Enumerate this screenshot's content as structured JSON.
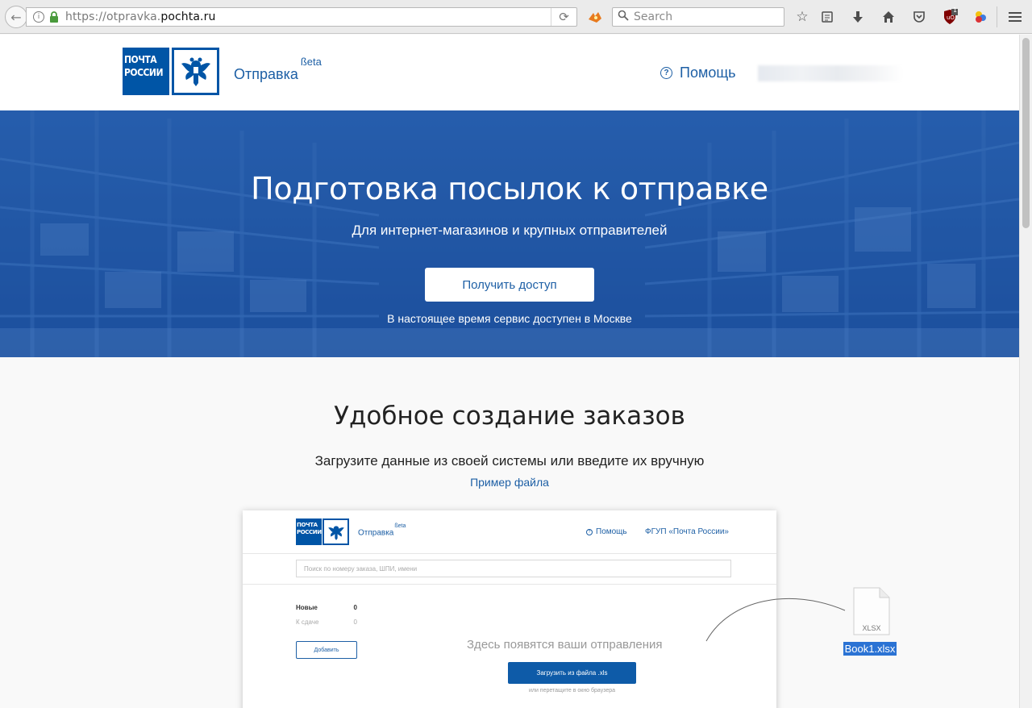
{
  "browser": {
    "url_prefix": "https://otpravka.",
    "url_domain": "pochta.ru",
    "search_placeholder": "Search",
    "ublock_count": "1"
  },
  "header": {
    "logo_line1": "ПОЧТА",
    "logo_line2": "РОССИИ",
    "brand": "Отправка",
    "brand_sup": "ßeta",
    "help": "Помощь"
  },
  "hero": {
    "title": "Подготовка посылок к отправке",
    "subtitle": "Для интернет-магазинов и крупных отправителей",
    "button": "Получить доступ",
    "note": "В настоящее время сервис доступен в Москве"
  },
  "features": {
    "title": "Удобное создание заказов",
    "subtitle": "Загрузите данные из своей системы или введите их вручную",
    "example_link": "Пример файла"
  },
  "mock": {
    "logo_line1": "ПОЧТА",
    "logo_line2": "РОССИИ",
    "brand": "Отправка",
    "brand_sup": "ßeta",
    "help": "Помощь",
    "org": "ФГУП «Почта России»",
    "search_placeholder": "Поиск по номеру заказа, ШПИ, имени",
    "side": [
      {
        "label": "Новые",
        "count": "0"
      },
      {
        "label": "К сдаче",
        "count": "0"
      }
    ],
    "add_button": "Добавить",
    "empty_text": "Здесь появятся ваши отправления",
    "upload_button": "Загрузить из файла .xls",
    "drag_hint": "или перетащите в окно браузера"
  },
  "file": {
    "ext": "XLSX",
    "name": "Book1.xlsx"
  },
  "colors": {
    "brand_blue": "#0055a6",
    "link_blue": "#1d5fa5",
    "hero_blue": "#1f56a6"
  }
}
